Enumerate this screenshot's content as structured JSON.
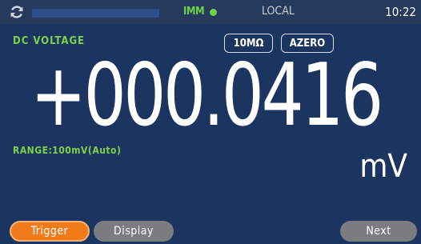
{
  "status": {
    "imm_label": "IMM",
    "mode_label": "LOCAL",
    "time": "10:22"
  },
  "measurement": {
    "function_label": "DC VOLTAGE",
    "impedance_label": "10MΩ",
    "autozero_label": "AZERO",
    "reading": "+000.0416",
    "range_label": "RANGE:100mV(Auto)",
    "unit": "mV"
  },
  "softkeys": {
    "trigger": "Trigger",
    "display": "Display",
    "next": "Next"
  },
  "colors": {
    "background": "#1c3560",
    "accent_green": "#7ed24a",
    "trigger_orange": "#f07b1a",
    "button_gray": "#7a7c80"
  }
}
